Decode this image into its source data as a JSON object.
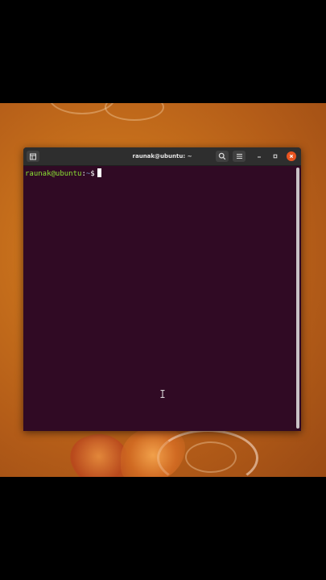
{
  "window": {
    "title": "raunak@ubuntu: ~"
  },
  "terminal": {
    "prompt_user_host": "raunak@ubuntu",
    "prompt_colon": ":",
    "prompt_path": "~",
    "prompt_symbol": "$"
  },
  "icons": {
    "new_tab": "new-tab-icon",
    "search": "search-icon",
    "menu": "hamburger-menu-icon",
    "minimize": "minimize-icon",
    "maximize": "maximize-icon",
    "close": "close-icon",
    "mouse_cursor": "ibeam-cursor-icon"
  },
  "colors": {
    "terminal_background": "#300a24",
    "prompt_user_host": "#8ae234",
    "prompt_path": "#729fcf",
    "close_button": "#e95420",
    "titlebar": "#2e2e2e",
    "desktop_orange": "#c8711c"
  }
}
